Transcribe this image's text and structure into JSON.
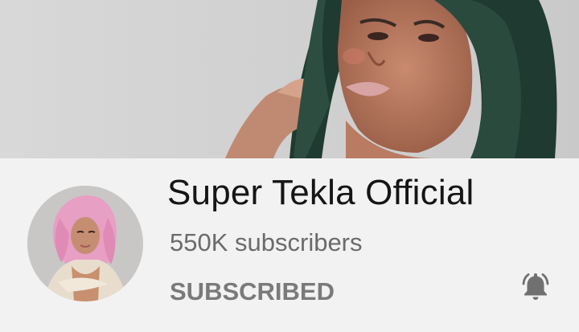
{
  "channel": {
    "name": "Super Tekla Official",
    "subscribers": "550K subscribers",
    "subscribe_state_label": "SUBSCRIBED"
  },
  "icons": {
    "notifications": "bell-ringing-icon"
  },
  "colors": {
    "background": "#f2f2f2",
    "title_text": "#151515",
    "secondary_text": "#6b6b6b",
    "subscribed_text": "#7a7a7a",
    "bell_icon": "#707070"
  }
}
